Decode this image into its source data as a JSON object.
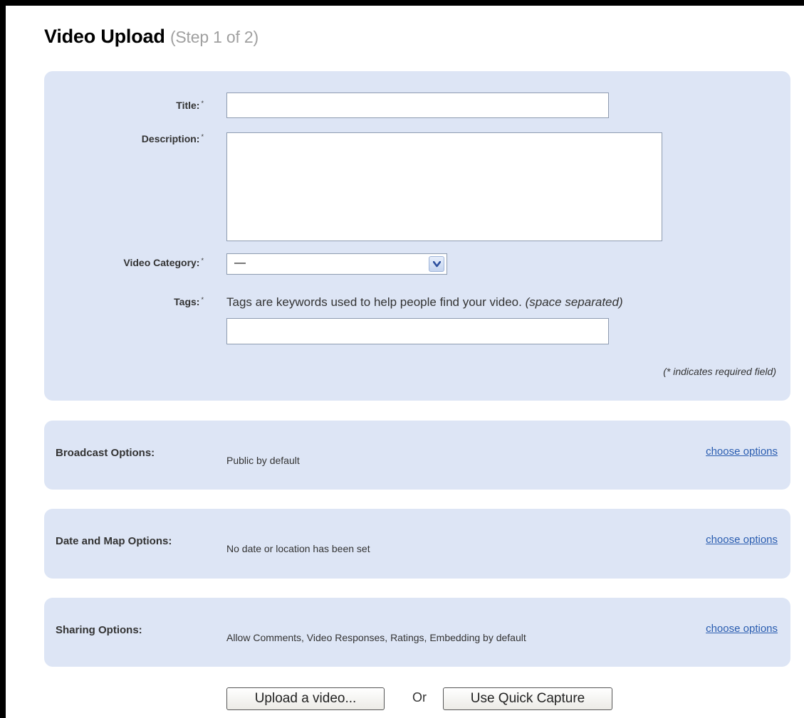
{
  "header": {
    "title": "Video Upload",
    "step": "(Step 1 of 2)"
  },
  "form": {
    "title_label": "Title:",
    "title_value": "",
    "description_label": "Description:",
    "description_value": "",
    "category_label": "Video Category:",
    "category_selected": "—",
    "tags_label": "Tags:",
    "tags_help": "Tags are keywords used to help people find your video.",
    "tags_help_italic": "(space separated)",
    "tags_value": "",
    "required_marker": "*",
    "required_note": "(* indicates required field)"
  },
  "options": {
    "broadcast": {
      "label": "Broadcast Options:",
      "value": "Public by default",
      "link": "choose options"
    },
    "date_map": {
      "label": "Date and Map Options:",
      "value": "No date or location has been set",
      "link": "choose options"
    },
    "sharing": {
      "label": "Sharing Options:",
      "value": "Allow Comments, Video Responses, Ratings, Embedding by default",
      "link": "choose options"
    }
  },
  "actions": {
    "upload_label": "Upload a video...",
    "or_text": "Or",
    "capture_label": "Use Quick Capture"
  },
  "colors": {
    "panel_bg": "#dde5f5",
    "link": "#2a5db0",
    "frame": "#000000"
  },
  "icons": {
    "select_arrow": "chevron-down-icon"
  }
}
